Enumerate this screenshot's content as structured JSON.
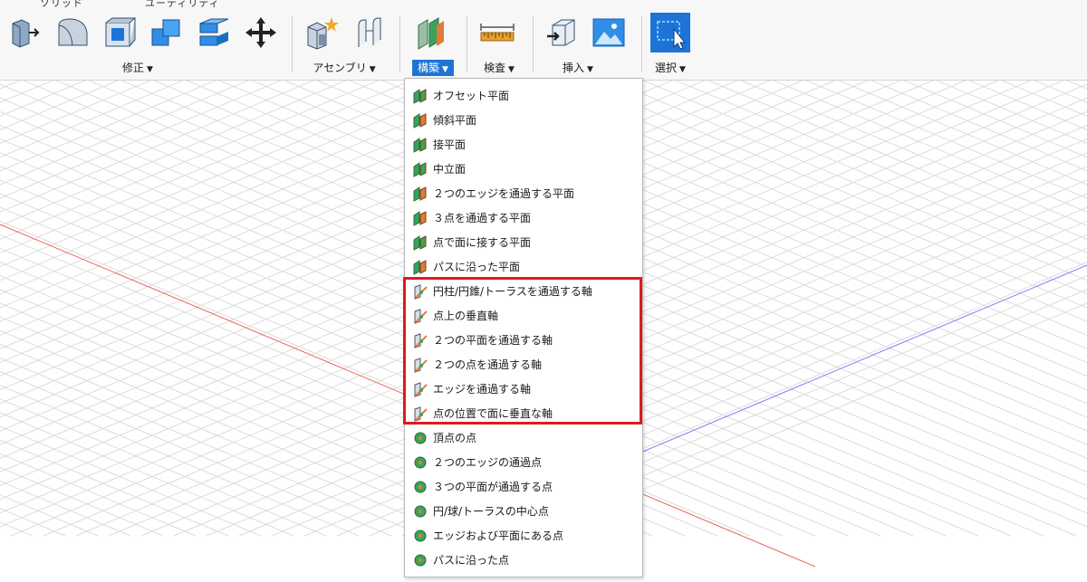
{
  "toolbar": {
    "tab_left": "ソリッド",
    "tab_mid": "ユーティリティ",
    "groups": {
      "modify": {
        "label": "修正"
      },
      "assemble": {
        "label": "アセンブリ"
      },
      "construct": {
        "label": "構築"
      },
      "inspect": {
        "label": "検査"
      },
      "insert": {
        "label": "挿入"
      },
      "select": {
        "label": "選択"
      }
    }
  },
  "menu": {
    "items": [
      {
        "label": "オフセット平面",
        "icon": "offset-plane-icon"
      },
      {
        "label": "傾斜平面",
        "icon": "plane-at-angle-icon"
      },
      {
        "label": "接平面",
        "icon": "tangent-plane-icon"
      },
      {
        "label": "中立面",
        "icon": "midplane-icon"
      },
      {
        "label": "２つのエッジを通過する平面",
        "icon": "plane-through-two-edges-icon"
      },
      {
        "label": "３点を通過する平面",
        "icon": "plane-through-three-points-icon"
      },
      {
        "label": "点で面に接する平面",
        "icon": "plane-tangent-at-point-icon"
      },
      {
        "label": "パスに沿った平面",
        "icon": "plane-along-path-icon"
      },
      {
        "label": "円柱/円錐/トーラスを通過する軸",
        "icon": "axis-through-cylinder-icon"
      },
      {
        "label": "点上の垂直軸",
        "icon": "axis-perpendicular-at-point-icon"
      },
      {
        "label": "２つの平面を通過する軸",
        "icon": "axis-through-two-planes-icon"
      },
      {
        "label": "２つの点を通過する軸",
        "icon": "axis-through-two-points-icon"
      },
      {
        "label": "エッジを通過する軸",
        "icon": "axis-through-edge-icon"
      },
      {
        "label": "点の位置で面に垂直な軸",
        "icon": "axis-perpendicular-to-face-icon"
      },
      {
        "label": "頂点の点",
        "icon": "point-at-vertex-icon"
      },
      {
        "label": "２つのエッジの通過点",
        "icon": "point-through-two-edges-icon"
      },
      {
        "label": "３つの平面が通過する点",
        "icon": "point-through-three-planes-icon"
      },
      {
        "label": "円/球/トーラスの中心点",
        "icon": "point-at-center-icon"
      },
      {
        "label": "エッジおよび平面にある点",
        "icon": "point-at-edge-and-plane-icon"
      },
      {
        "label": "パスに沿った点",
        "icon": "point-along-path-icon"
      }
    ]
  },
  "colors": {
    "accent": "#1e74d6",
    "highlight": "#e0191f",
    "x_axis": "#e8675e",
    "z_axis": "#7d7ff0",
    "icon_green": "#3aa35a",
    "icon_orange": "#e07b39"
  }
}
